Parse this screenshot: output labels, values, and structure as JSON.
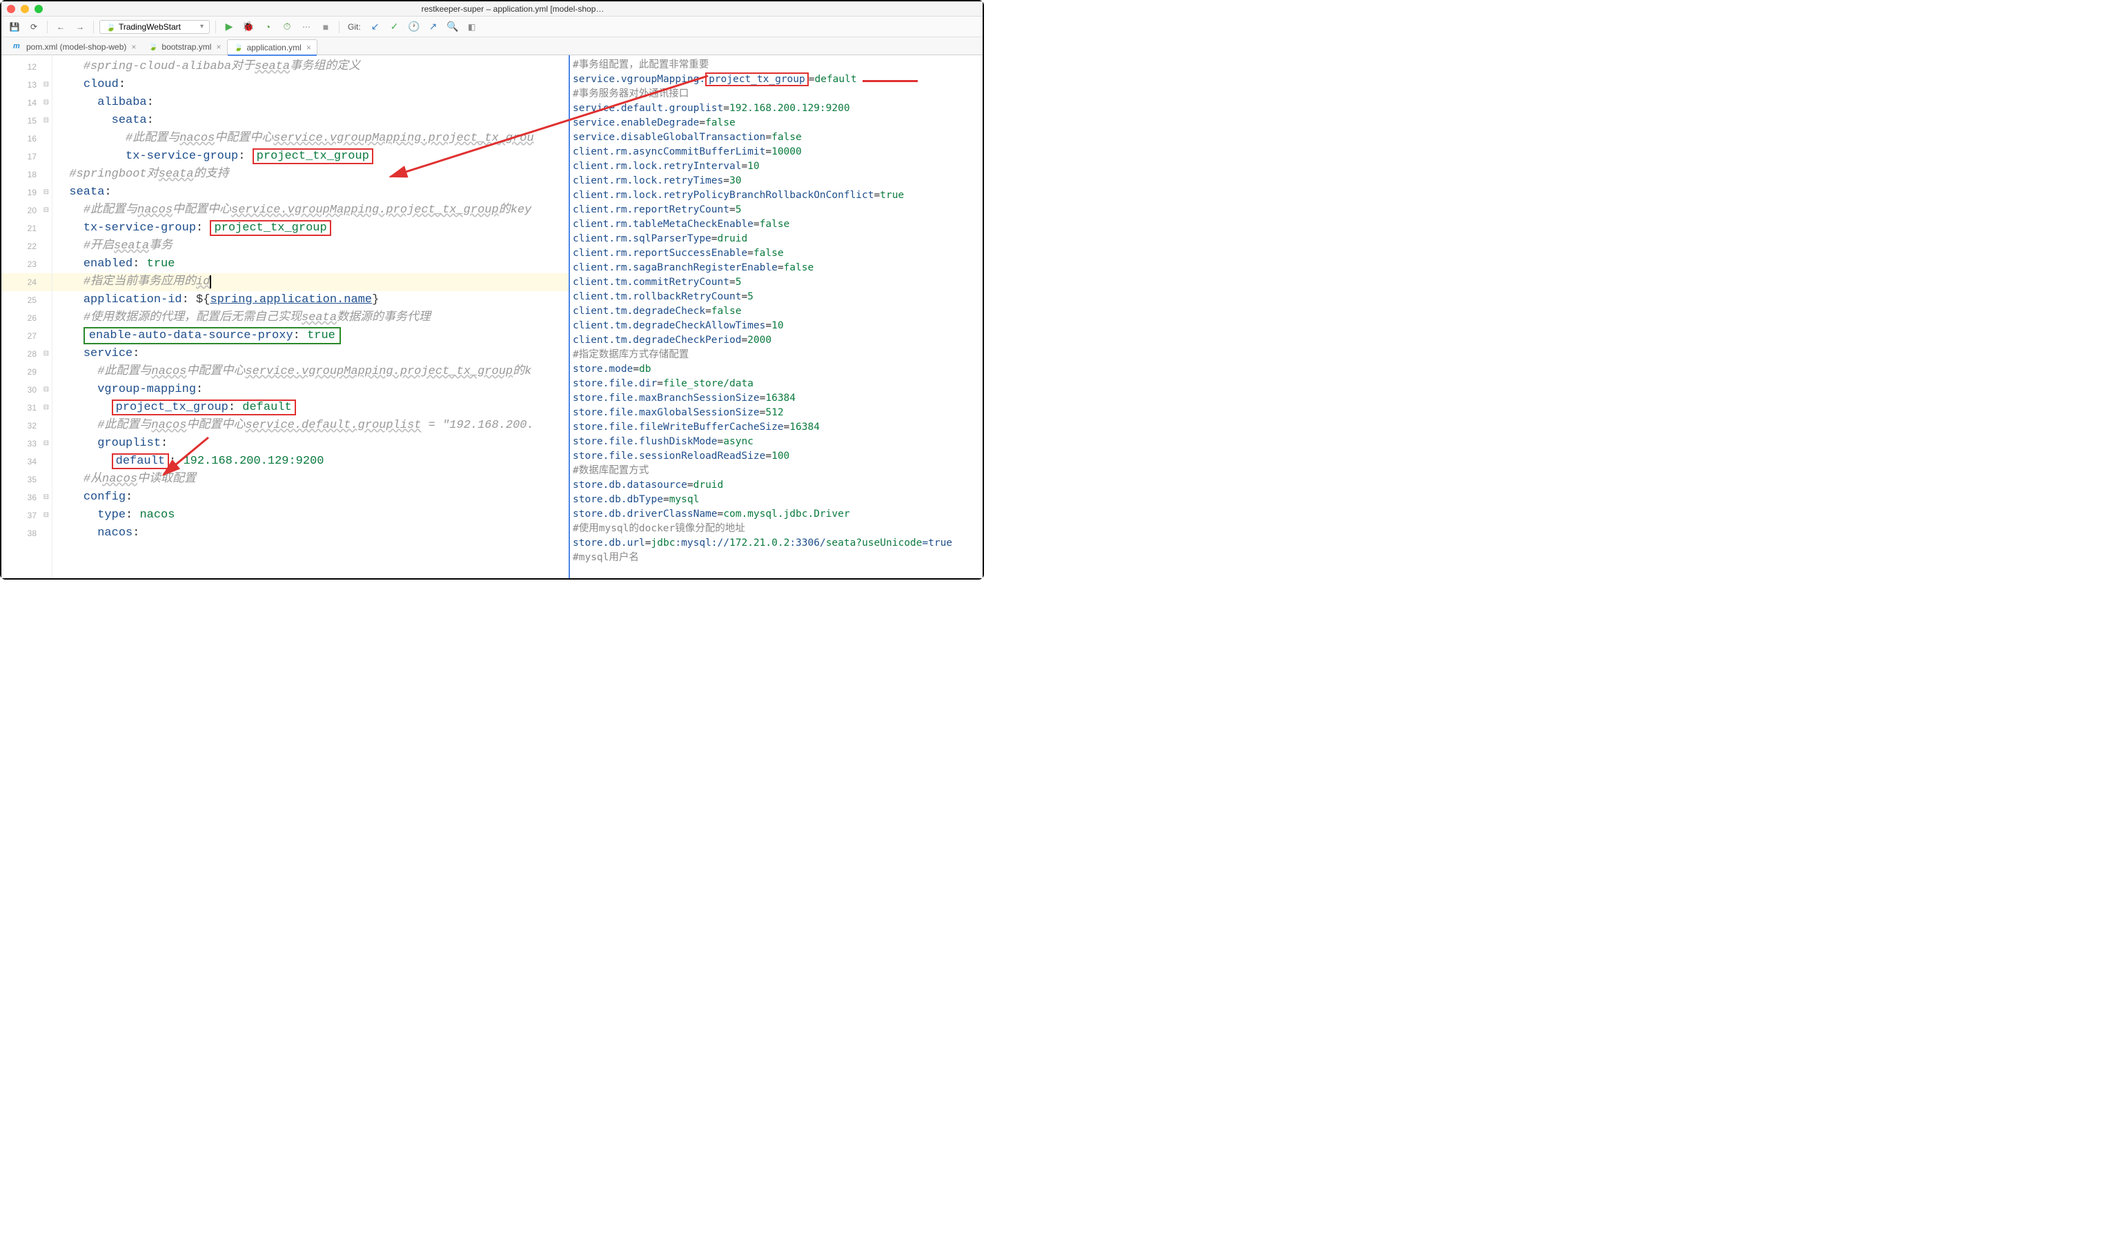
{
  "window": {
    "title": "restkeeper-super – application.yml [model-shop…"
  },
  "toolbar": {
    "run_config": "TradingWebStart",
    "git_label": "Git:"
  },
  "tabs": [
    {
      "label": "pom.xml (model-shop-web)",
      "icon": "m"
    },
    {
      "label": "bootstrap.yml",
      "icon": "leaf"
    },
    {
      "label": "application.yml",
      "icon": "leaf",
      "active": true
    }
  ],
  "gutter": {
    "start": 12,
    "end": 38,
    "selected": 24
  },
  "code": {
    "lines": [
      {
        "indent": 2,
        "type": "comment",
        "text": "#spring-cloud-alibaba对于",
        "u": "seata",
        "text2": "事务组的定义"
      },
      {
        "indent": 2,
        "type": "key",
        "key": "cloud",
        "colon": ":"
      },
      {
        "indent": 3,
        "type": "key",
        "key": "alibaba",
        "colon": ":"
      },
      {
        "indent": 4,
        "type": "key",
        "key": "seata",
        "colon": ":"
      },
      {
        "indent": 5,
        "type": "comment",
        "text": "#此配置与",
        "u": "nacos",
        "text2": "中配置中心",
        "u2": "service.vgroupMapping.project_tx_grou"
      },
      {
        "indent": 5,
        "type": "kv",
        "key": "tx-service-group",
        "colon": ": ",
        "boxed": "project_tx_group"
      },
      {
        "indent": 1,
        "type": "comment",
        "text": "#springboot对",
        "u": "seata",
        "text2": "的支持"
      },
      {
        "indent": 1,
        "type": "key",
        "key": "seata",
        "colon": ":"
      },
      {
        "indent": 2,
        "type": "comment",
        "text": "#此配置与",
        "u": "nacos",
        "text2": "中配置中心",
        "u2": "service.vgroupMapping.project_tx_group",
        "text3": "的key"
      },
      {
        "indent": 2,
        "type": "kv",
        "key": "tx-service-group",
        "colon": ": ",
        "boxed": "project_tx_group"
      },
      {
        "indent": 2,
        "type": "comment",
        "text": "#开启",
        "u": "seata",
        "text2": "事务"
      },
      {
        "indent": 2,
        "type": "kv",
        "key": "enabled",
        "colon": ": ",
        "val": "true"
      },
      {
        "indent": 2,
        "type": "comment",
        "text": "#指定当前事务应用的",
        "u": "id",
        "caret": true,
        "selected": true
      },
      {
        "indent": 2,
        "type": "kv",
        "key": "application-id",
        "colon": ": ",
        "tpl_pre": "${",
        "tpl": "spring.application.name",
        "tpl_post": "}"
      },
      {
        "indent": 2,
        "type": "comment",
        "text": "#使用数据源的代理，配置后无需自己实现",
        "u": "seata",
        "text2": "数据源的事务代理"
      },
      {
        "indent": 2,
        "type": "kv-green",
        "key": "enable-auto-data-source-proxy",
        "colon": ": ",
        "val": "true"
      },
      {
        "indent": 2,
        "type": "key",
        "key": "service",
        "colon": ":"
      },
      {
        "indent": 3,
        "type": "comment",
        "text": "#此配置与",
        "u": "nacos",
        "text2": "中配置中心",
        "u2": "service.vgroupMapping.project_tx_group",
        "text3": "的k"
      },
      {
        "indent": 3,
        "type": "key",
        "key": "vgroup-mapping",
        "colon": ":"
      },
      {
        "indent": 4,
        "type": "kv",
        "boxed_key": "project_tx_group",
        "colon": ": ",
        "val": "default",
        "box_wide": true
      },
      {
        "indent": 3,
        "type": "comment",
        "text": "#此配置与",
        "u": "nacos",
        "text2": "中配置中心",
        "u2": "service.default.grouplist",
        "text3": " = \"192.168.200."
      },
      {
        "indent": 3,
        "type": "key",
        "key": "grouplist",
        "colon": ":"
      },
      {
        "indent": 4,
        "type": "kv",
        "boxed_key": "default",
        "colon": ": ",
        "val": "192.168.200.129:9200"
      },
      {
        "indent": 2,
        "type": "comment",
        "text": "#从",
        "u": "nacos",
        "text2": "中读取配置"
      },
      {
        "indent": 2,
        "type": "key",
        "key": "config",
        "colon": ":"
      },
      {
        "indent": 3,
        "type": "kv",
        "key": "type",
        "colon": ": ",
        "val": "nacos"
      },
      {
        "indent": 3,
        "type": "key",
        "key": "nacos",
        "colon": ":"
      }
    ]
  },
  "right": {
    "lines": [
      {
        "type": "c",
        "text": "#事务组配置，此配置非常重要"
      },
      {
        "type": "kv",
        "k": "service.vgroupMapping.",
        "boxed": "project_tx_group",
        "v": "default",
        "underline_after": true
      },
      {
        "type": "c",
        "text": "#事务服务器对外通讯接口"
      },
      {
        "type": "kv",
        "k": "service.default.grouplist",
        "v": "192.168.200.129:9200"
      },
      {
        "type": "kv",
        "k": "service.enableDegrade",
        "v": "false"
      },
      {
        "type": "kv",
        "k": "service.disableGlobalTransaction",
        "v": "false"
      },
      {
        "type": "kv",
        "k": "client.rm.asyncCommitBufferLimit",
        "v": "10000"
      },
      {
        "type": "kv",
        "k": "client.rm.lock.retryInterval",
        "v": "10"
      },
      {
        "type": "kv",
        "k": "client.rm.lock.retryTimes",
        "v": "30"
      },
      {
        "type": "kv",
        "k": "client.rm.lock.retryPolicyBranchRollbackOnConflict",
        "v": "true"
      },
      {
        "type": "kv",
        "k": "client.rm.reportRetryCount",
        "v": "5"
      },
      {
        "type": "kv",
        "k": "client.rm.tableMetaCheckEnable",
        "v": "false"
      },
      {
        "type": "kv",
        "k": "client.rm.sqlParserType",
        "v": "druid"
      },
      {
        "type": "kv",
        "k": "client.rm.reportSuccessEnable",
        "v": "false"
      },
      {
        "type": "kv",
        "k": "client.rm.sagaBranchRegisterEnable",
        "v": "false"
      },
      {
        "type": "kv",
        "k": "client.tm.commitRetryCount",
        "v": "5"
      },
      {
        "type": "kv",
        "k": "client.tm.rollbackRetryCount",
        "v": "5"
      },
      {
        "type": "kv",
        "k": "client.tm.degradeCheck",
        "v": "false"
      },
      {
        "type": "kv",
        "k": "client.tm.degradeCheckAllowTimes",
        "v": "10"
      },
      {
        "type": "kv",
        "k": "client.tm.degradeCheckPeriod",
        "v": "2000"
      },
      {
        "type": "c",
        "text": "#指定数据库方式存储配置"
      },
      {
        "type": "kv",
        "k": "store.mode",
        "v": "db"
      },
      {
        "type": "kv",
        "k": "store.file.dir",
        "v": "file_store/data"
      },
      {
        "type": "kv",
        "k": "store.file.maxBranchSessionSize",
        "v": "16384"
      },
      {
        "type": "kv",
        "k": "store.file.maxGlobalSessionSize",
        "v": "512"
      },
      {
        "type": "kv",
        "k": "store.file.fileWriteBufferCacheSize",
        "v": "16384"
      },
      {
        "type": "kv",
        "k": "store.file.flushDiskMode",
        "v": "async"
      },
      {
        "type": "kv",
        "k": "store.file.sessionReloadReadSize",
        "v": "100"
      },
      {
        "type": "c",
        "text": "#数据库配置方式"
      },
      {
        "type": "kv",
        "k": "store.db.datasource",
        "v": "druid"
      },
      {
        "type": "kv",
        "k": "store.db.dbType",
        "v": "mysql"
      },
      {
        "type": "kv",
        "k": "store.db.driverClassName",
        "v": "com.mysql.jdbc.Driver"
      },
      {
        "type": "c",
        "text": "#使用mysql的docker镜像分配的地址"
      },
      {
        "type": "url",
        "k": "store.db.url",
        "pre": "jdbc",
        "mid": ":mysql://",
        "host": "172.21.0.2",
        "port": ":3306/",
        "path": "seata?useUnicode",
        "tail": "=true"
      },
      {
        "type": "c",
        "text": "#mysql用户名"
      }
    ]
  }
}
